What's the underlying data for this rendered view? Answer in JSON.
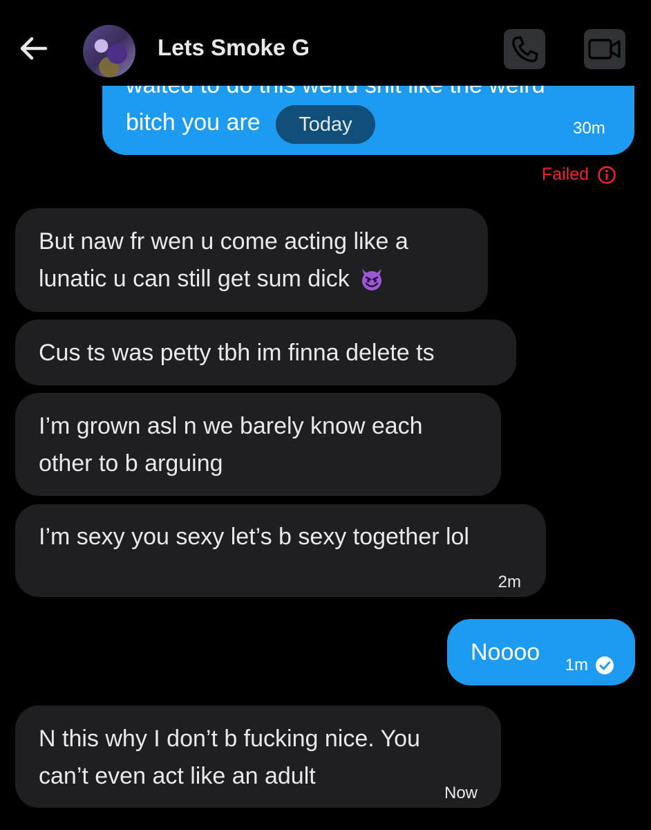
{
  "header": {
    "title": "Lets Smoke G",
    "back_icon": "arrow-left-icon",
    "call_icon": "phone-icon",
    "video_icon": "video-camera-icon"
  },
  "date_separator": "Today",
  "messages": [
    {
      "direction": "outgoing",
      "lines": [
        "waited to do this weird shit like the weird",
        "bitch you are"
      ],
      "time": "30m",
      "status": "Failed",
      "status_icon": "info-icon"
    },
    {
      "direction": "incoming",
      "lines": [
        "But naw fr wen u come acting like a",
        "lunatic u can still get sum dick"
      ],
      "emoji": "smiling-devil-emoji"
    },
    {
      "direction": "incoming",
      "lines": [
        "Cus ts was petty tbh im finna delete ts"
      ]
    },
    {
      "direction": "incoming",
      "lines": [
        "I’m grown asl n we barely know each",
        "other to b arguing"
      ]
    },
    {
      "direction": "incoming",
      "lines": [
        "I’m sexy you sexy let’s b sexy together lol"
      ],
      "time": "2m"
    },
    {
      "direction": "outgoing",
      "lines": [
        "Noooo"
      ],
      "time": "1m",
      "status_icon": "check-circle-icon"
    },
    {
      "direction": "incoming",
      "lines": [
        "N this why I don’t b fucking nice. You",
        "can’t even act like an adult"
      ],
      "time": "Now"
    }
  ],
  "colors": {
    "background": "#000000",
    "incoming_bubble": "#1f1f22",
    "outgoing_bubble": "#1d9bf0",
    "failed": "#f4212e"
  }
}
